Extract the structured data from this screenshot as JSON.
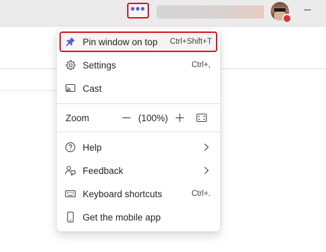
{
  "titlebar": {
    "more_icon": "more-horizontal-icon",
    "dots": "•••",
    "minimize_icon": "minimize-icon"
  },
  "menu": {
    "pin": {
      "label": "Pin window on top",
      "shortcut": "Ctrl+Shift+T",
      "icon": "pin-icon"
    },
    "settings": {
      "label": "Settings",
      "shortcut": "Ctrl+,",
      "icon": "gear-icon"
    },
    "cast": {
      "label": "Cast",
      "icon": "cast-icon"
    },
    "zoom": {
      "label": "Zoom",
      "value": "(100%)",
      "minus_icon": "minus-icon",
      "plus_icon": "plus-icon",
      "fit_icon": "fit-screen-icon"
    },
    "help": {
      "label": "Help",
      "icon": "help-circle-icon"
    },
    "feedback": {
      "label": "Feedback",
      "icon": "feedback-icon"
    },
    "shortcuts": {
      "label": "Keyboard shortcuts",
      "shortcut": "Ctrl+.",
      "icon": "keyboard-icon"
    },
    "mobile": {
      "label": "Get the mobile app",
      "icon": "phone-icon"
    }
  },
  "colors": {
    "accent": "#5b5fc7",
    "highlight_border": "#d4141c",
    "presence_busy": "#d13438"
  }
}
